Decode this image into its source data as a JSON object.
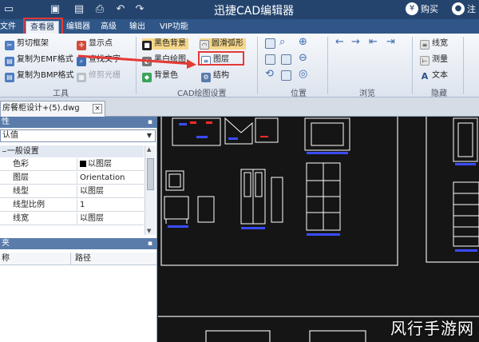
{
  "titlebar": {
    "app_title": "迅捷CAD编辑器",
    "buy_label": "购买",
    "register_label": "注",
    "quick_access": [
      "folder-icon",
      "save-icon",
      "save-as-icon",
      "print-icon",
      "undo-icon",
      "redo-icon"
    ]
  },
  "menu": {
    "tabs": [
      "文件",
      "查看器",
      "编辑器",
      "高级",
      "输出",
      "VIP功能"
    ],
    "active": "查看器"
  },
  "ribbon": {
    "tools": {
      "items": [
        "剪切框架",
        "复制为EMF格式",
        "复制为BMP格式",
        "显示点",
        "查找文字",
        "修剪光栅"
      ],
      "group_label": "工具"
    },
    "cad_settings": {
      "items": [
        "黑色背景",
        "圆滑弧形",
        "黑白绘图",
        "图层",
        "背景色",
        "结构"
      ],
      "group_label": "CAD绘图设置"
    },
    "position": {
      "group_label": "位置"
    },
    "browse": {
      "group_label": "浏览"
    },
    "hide": {
      "items": [
        "线宽",
        "测量",
        "文本"
      ],
      "group_label": "隐藏"
    }
  },
  "document_tab": {
    "label": "房餐柜设计+(5).dwg",
    "close": "×"
  },
  "properties": {
    "header": "性",
    "dropdown_value": "认值",
    "section": "一般设置",
    "rows": [
      {
        "key": "色彩",
        "value": "以图层"
      },
      {
        "key": "图层",
        "value": "Orientation"
      },
      {
        "key": "线型",
        "value": "以图层"
      },
      {
        "key": "线型比例",
        "value": "1"
      },
      {
        "key": "线宽",
        "value": "以图层"
      }
    ]
  },
  "files_panel": {
    "header": "夹",
    "columns": [
      "称",
      "路径"
    ]
  },
  "watermark": "风行手游网",
  "colors": {
    "title_bg": "#24446e",
    "menu_bg": "#2f5687",
    "highlight": "#e53935",
    "canvas_bg": "#151515",
    "drawing_line": "#ffffff",
    "accent_blue": "#3a4cff",
    "accent_red": "#ff2a2a"
  }
}
